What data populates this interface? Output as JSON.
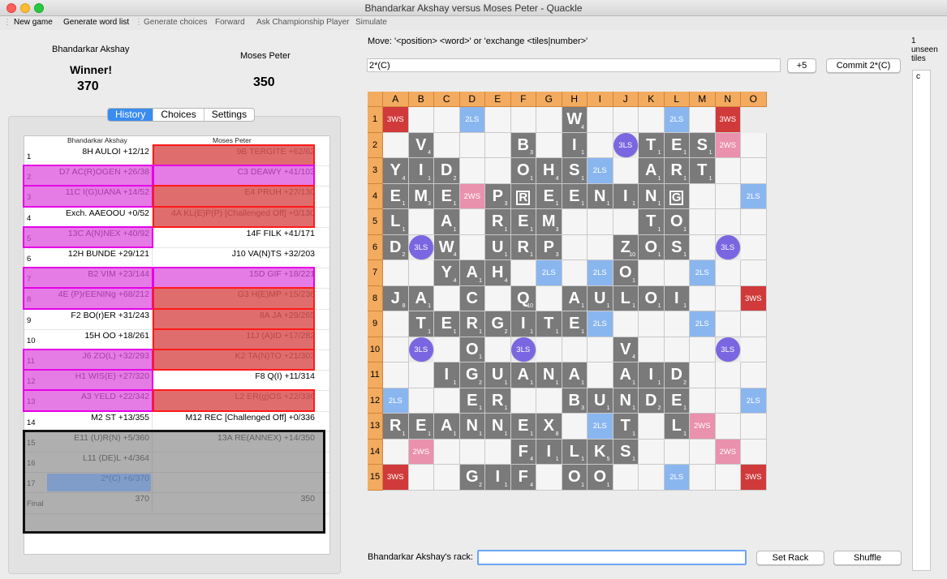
{
  "window": {
    "title": "Bhandarkar Akshay versus Moses Peter - Quackle"
  },
  "toolbar": {
    "new_game": "New game",
    "generate_word_list": "Generate word list",
    "generate_choices": "Generate choices",
    "forward": "Forward",
    "ask_championship_player": "Ask Championship Player",
    "simulate": "Simulate"
  },
  "players": {
    "p1": {
      "name": "Bhandarkar Akshay",
      "status": "Winner!",
      "score": "370"
    },
    "p2": {
      "name": "Moses Peter",
      "score": "350"
    }
  },
  "tabs": {
    "history": "History",
    "choices": "Choices",
    "settings": "Settings"
  },
  "history": {
    "col1": "Bhandarkar Akshay",
    "col2": "Moses Peter",
    "rows": [
      {
        "n": "1",
        "a": "8H AULOI    +12/12",
        "b": "9B TERGITE    +62/62"
      },
      {
        "n": "2",
        "a": "D7 AC(R)OGEN    +26/38",
        "b": "C3 DEAWY    +41/103"
      },
      {
        "n": "3",
        "a": "11C I(G)UANA    +14/52",
        "b": "E4 PRUH    +27/130"
      },
      {
        "n": "4",
        "a": "Exch. AAEOOU    +0/52",
        "b": "4A KL(E)P(P) [Challenged Off]    +0/130"
      },
      {
        "n": "5",
        "a": "13C A(N)NEX    +40/92",
        "b": "14F FILK    +41/171"
      },
      {
        "n": "6",
        "a": "12H BUNDE    +29/121",
        "b": "J10 VA(N)TS    +32/203"
      },
      {
        "n": "7",
        "a": "B2 VIM    +23/144",
        "b": "15D GIF    +18/221"
      },
      {
        "n": "8",
        "a": "4E (P)rEENINg    +68/212",
        "b": "G3 H(E)MP    +15/236"
      },
      {
        "n": "9",
        "a": "F2 BO(r)ER    +31/243",
        "b": "8A JA    +29/265"
      },
      {
        "n": "10",
        "a": "15H OO    +18/261",
        "b": "11J (A)ID    +17/282"
      },
      {
        "n": "11",
        "a": "J6 ZO(L)    +32/293",
        "b": "K2 TA(N)TO    +21/303"
      },
      {
        "n": "12",
        "a": "H1 WIS(E)    +27/320",
        "b": "F8 Q(I)    +11/314"
      },
      {
        "n": "13",
        "a": "A3 YELD    +22/342",
        "b": "L2 ER(g)OS    +22/336"
      },
      {
        "n": "14",
        "a": "M2 ST    +13/355",
        "b": "M12 REC [Challenged Off]    +0/336"
      },
      {
        "n": "15",
        "a": "E11 (U)R(N)    +5/360",
        "b": "13A RE(ANNEX)    +14/350"
      },
      {
        "n": "16",
        "a": "L11 (DE)L    +4/364",
        "b": ""
      },
      {
        "n": "17",
        "a": "2*(C)    +6/370",
        "b": ""
      },
      {
        "n": "Final",
        "a": "370",
        "b": "350"
      }
    ]
  },
  "move": {
    "prompt": "Move: '<position> <word>' or 'exchange <tiles|number>'",
    "value": "2*(C)",
    "plus_label": "+5",
    "commit_label": "Commit 2*(C)"
  },
  "board": {
    "cols": [
      "A",
      "B",
      "C",
      "D",
      "E",
      "F",
      "G",
      "H",
      "I",
      "J",
      "K",
      "L",
      "M",
      "N",
      "O"
    ],
    "rows": [
      "1",
      "2",
      "3",
      "4",
      "5",
      "6",
      "7",
      "8",
      "9",
      "10",
      "11",
      "12",
      "13",
      "14",
      "15"
    ],
    "premium": [
      "3WS . . 2LS . . . W . . . 2LS . 3WS",
      ". V . . . B . I . 3LS T E S 2WS .",
      "Y I D . . O H S 2LS . A R T . .",
      "E M E 2WS P [R] E E N I N [G] . . 2LS",
      "L . A . R E M . . . T O . . .",
      "D 3LS W . U R P . . Z O S . 3LS .",
      ". . Y A H . 2LS . 2LS O . . 2LS . .",
      "J A . C . Q . A U L O I . . 3WS",
      ". T E R G I T E 2LS . . . 2LS . .",
      ". 3LS . O . 3LS . . . V . . . 3LS .",
      ". . I G U A N A . A I D . . .",
      "2LS . . E R . . B U N D E . . 2LS",
      "R E A N N E X . 2LS T . L 2WS . .",
      ". 2WS . . . F I L K S . . . 2WS .",
      "3WS . . G I F . O O . . 2LS . . 3WS"
    ],
    "points": {
      "W": "4",
      "V": "4",
      "B": "3",
      "I": "1",
      "T": "1",
      "E": "1",
      "S": "1",
      "Y": "4",
      "D": "2",
      "O": "1",
      "H": "4",
      "A": "1",
      "R": "1",
      "M": "3",
      "P": "3",
      "N": "1",
      "L": "1",
      "U": "1",
      "Z": "10",
      "J": "8",
      "Q": "10",
      "G": "2",
      "X": "8",
      "F": "4",
      "K": "5"
    }
  },
  "rack": {
    "label": "Bhandarkar Akshay's rack:",
    "value": "",
    "set_rack": "Set Rack",
    "shuffle": "Shuffle"
  },
  "unseen": {
    "count": "1",
    "label": "unseen tiles",
    "tiles": "c"
  }
}
